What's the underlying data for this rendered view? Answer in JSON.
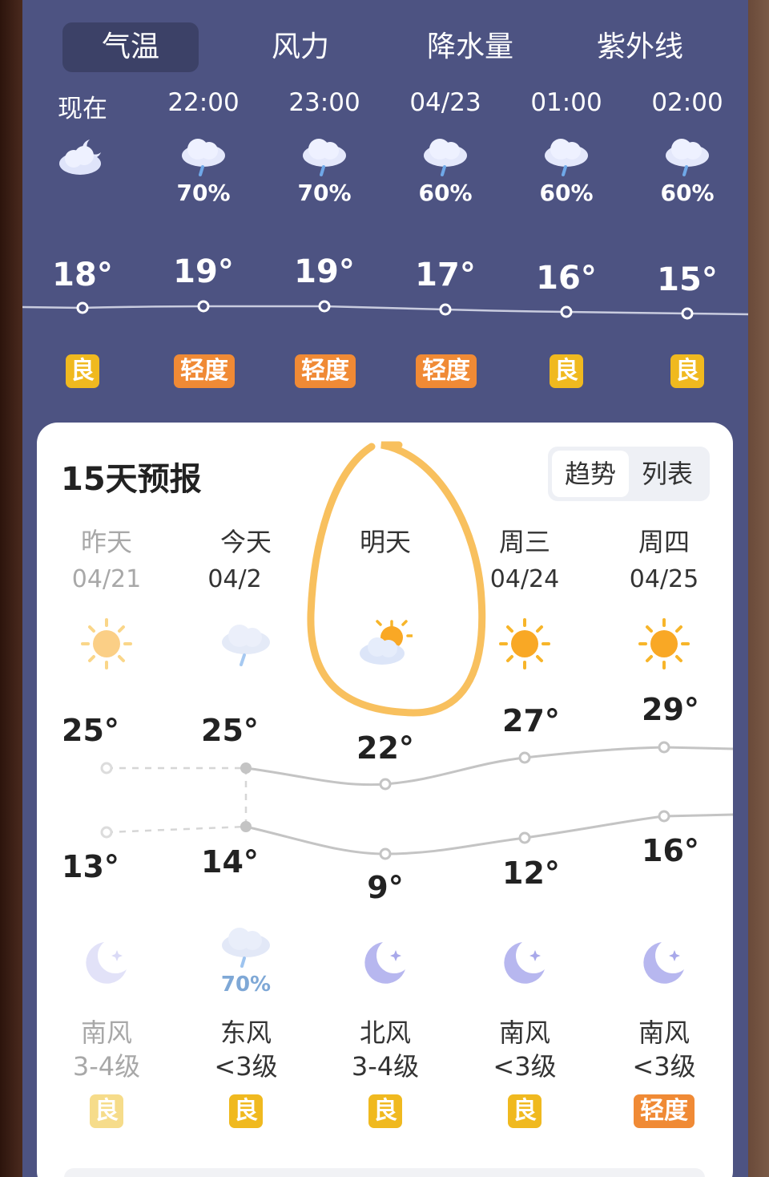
{
  "tabs": [
    "气温",
    "风力",
    "降水量",
    "紫外线"
  ],
  "hourly": [
    {
      "time": "现在",
      "icon": "moon-cloud-icon",
      "precip": "",
      "temp": "18°",
      "temp_value": 18,
      "aqi": "良",
      "aqi_level": "good"
    },
    {
      "time": "22:00",
      "icon": "rain-cloud-icon",
      "precip": "70%",
      "temp": "19°",
      "temp_value": 19,
      "aqi": "轻度",
      "aqi_level": "light"
    },
    {
      "time": "23:00",
      "icon": "rain-cloud-icon",
      "precip": "70%",
      "temp": "19°",
      "temp_value": 19,
      "aqi": "轻度",
      "aqi_level": "light"
    },
    {
      "time": "04/23",
      "icon": "rain-cloud-icon",
      "precip": "60%",
      "temp": "17°",
      "temp_value": 17,
      "aqi": "轻度",
      "aqi_level": "light"
    },
    {
      "time": "01:00",
      "icon": "rain-cloud-icon",
      "precip": "60%",
      "temp": "16°",
      "temp_value": 16,
      "aqi": "良",
      "aqi_level": "good"
    },
    {
      "time": "02:00",
      "icon": "rain-cloud-icon",
      "precip": "60%",
      "temp": "15°",
      "temp_value": 15,
      "aqi": "良",
      "aqi_level": "good"
    }
  ],
  "forecast": {
    "title": "15天预报",
    "toggle": {
      "trend": "趋势",
      "list": "列表"
    },
    "days": [
      {
        "name": "昨天",
        "date": "04/21",
        "day_icon": "sun-icon",
        "high": "25°",
        "high_value": 25,
        "low": "13°",
        "low_value": 13,
        "night_icon": "moon-icon",
        "night_precip": "",
        "wind_dir": "南风",
        "wind_level": "3-4级",
        "aqi": "良",
        "aqi_level": "good",
        "past": true
      },
      {
        "name": "今天",
        "date": "04/2",
        "day_icon": "rain-cloud-icon",
        "high": "25°",
        "high_value": 25,
        "low": "14°",
        "low_value": 14,
        "night_icon": "rain-cloud-icon",
        "night_precip": "70%",
        "wind_dir": "东风",
        "wind_level": "<3级",
        "aqi": "良",
        "aqi_level": "good",
        "past": false
      },
      {
        "name": "明天",
        "date": "",
        "day_icon": "partly-cloudy-icon",
        "high": "22°",
        "high_value": 22,
        "low": "9°",
        "low_value": 9,
        "night_icon": "moon-icon",
        "night_precip": "",
        "wind_dir": "北风",
        "wind_level": "3-4级",
        "aqi": "良",
        "aqi_level": "good",
        "past": false
      },
      {
        "name": "周三",
        "date": "04/24",
        "day_icon": "sun-icon",
        "high": "27°",
        "high_value": 27,
        "low": "12°",
        "low_value": 12,
        "night_icon": "moon-icon",
        "night_precip": "",
        "wind_dir": "南风",
        "wind_level": "<3级",
        "aqi": "良",
        "aqi_level": "good",
        "past": false
      },
      {
        "name": "周四",
        "date": "04/25",
        "day_icon": "sun-icon",
        "high": "29°",
        "high_value": 29,
        "low": "16°",
        "low_value": 16,
        "night_icon": "moon-icon",
        "night_precip": "",
        "wind_dir": "南风",
        "wind_level": "<3级",
        "aqi": "轻度",
        "aqi_level": "light",
        "past": false
      }
    ]
  },
  "colors": {
    "background": "#4d5382",
    "active_tab": "#3c4167",
    "aqi_good": "#f0b91f",
    "aqi_light": "#f08a35",
    "highlight_circle": "#f8c05e",
    "precip_text": "#7fa8d6"
  }
}
